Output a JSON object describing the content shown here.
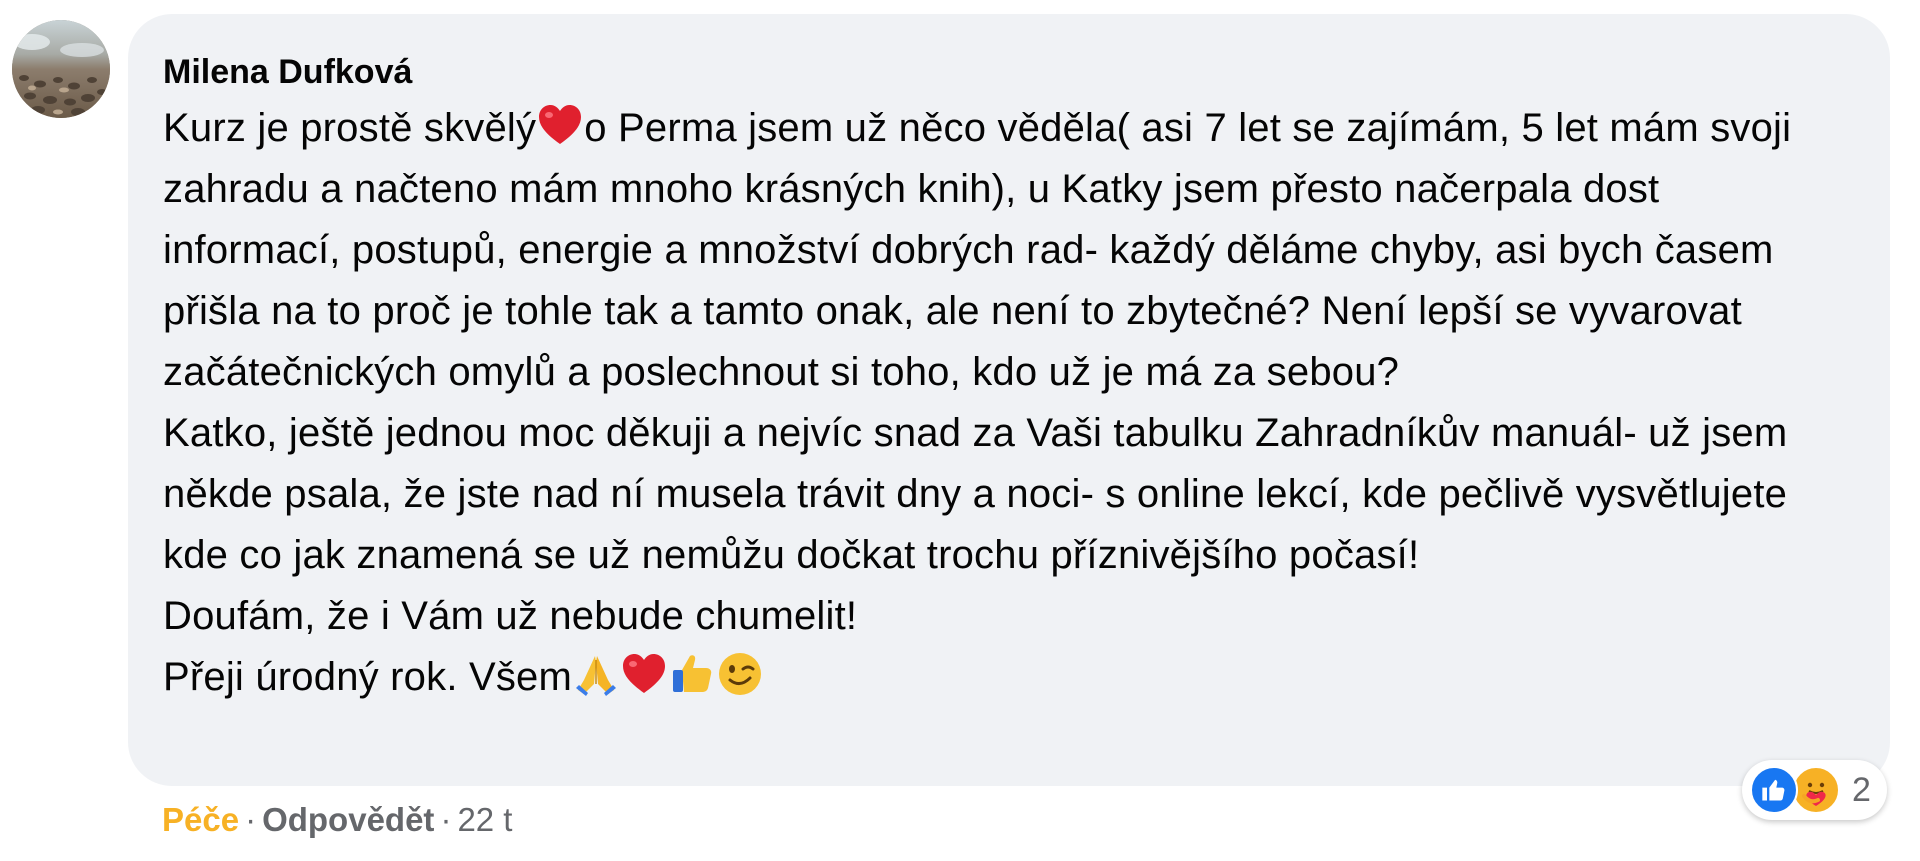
{
  "comment": {
    "author": "Milena Dufková",
    "paragraphs": [
      {
        "segments": [
          {
            "type": "text",
            "value": "Kurz je prostě skvělý"
          },
          {
            "type": "emoji",
            "value": "heart"
          },
          {
            "type": "text",
            "value": "o Perma jsem už něco věděla( asi 7 let se zajímám, 5 let mám svoji zahradu a načteno mám mnoho krásných knih), u Katky jsem přesto načerpala dost informací, postupů, energie a množství dobrých rad- každý děláme chyby, asi bych časem přišla na to proč je tohle tak a tamto onak, ale není to zbytečné? Není lepší se vyvarovat začátečnických omylů a poslechnout si toho, kdo už je má za sebou?"
          }
        ]
      },
      {
        "segments": [
          {
            "type": "text",
            "value": "Katko, ještě jednou moc děkuji a nejvíc snad za Vaši tabulku Zahradníkův manuál- už jsem někde psala, že jste nad ní musela trávit dny a noci- s online lekcí, kde pečlivě vysvětlujete kde co jak znamená se už nemůžu dočkat trochu příznivějšího počasí!"
          }
        ]
      },
      {
        "segments": [
          {
            "type": "text",
            "value": "Doufám, že i Vám už nebude chumelit!"
          }
        ]
      },
      {
        "segments": [
          {
            "type": "text",
            "value": "Přeji úrodný rok. Všem"
          },
          {
            "type": "emoji",
            "value": "folded-hands"
          },
          {
            "type": "emoji",
            "value": "heart"
          },
          {
            "type": "emoji",
            "value": "thumbs-up"
          },
          {
            "type": "emoji",
            "value": "winking-face"
          }
        ]
      }
    ],
    "reactions": {
      "icons": [
        "like-icon",
        "care-icon"
      ],
      "count": "2"
    },
    "actions": {
      "care_label": "Péče",
      "separator": "·",
      "reply_label": "Odpovědět",
      "time": "22 t"
    }
  },
  "colors": {
    "bubble": "#f0f2f5",
    "care": "#f7b125",
    "like": "#1877f2",
    "meta": "#65676b",
    "text": "#050505"
  }
}
